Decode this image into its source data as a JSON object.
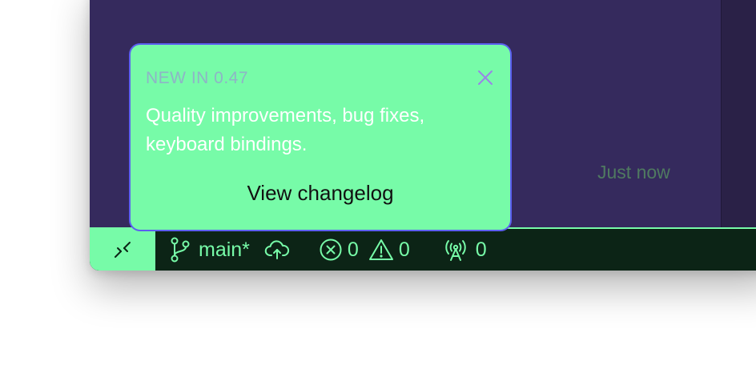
{
  "editor": {
    "timestamp": "Just now"
  },
  "toast": {
    "title": "NEW IN 0.47",
    "body": "Quality improvements, bug fixes, keyboard bindings.",
    "action_label": "View changelog",
    "close_icon": "close-icon"
  },
  "statusbar": {
    "remote_icon": "remote-connection-icon",
    "branch": "main*",
    "branch_icon": "git-branch-icon",
    "sync_icon": "cloud-upload-icon",
    "errors": "0",
    "warnings": "0",
    "ports": "0",
    "ports_icon": "broadcast-antenna-icon"
  },
  "colors": {
    "accent": "#77fba8",
    "editor_bg": "#352a5d",
    "statusbar_bg": "#0c2416",
    "toast_border": "#5b5ff0"
  }
}
